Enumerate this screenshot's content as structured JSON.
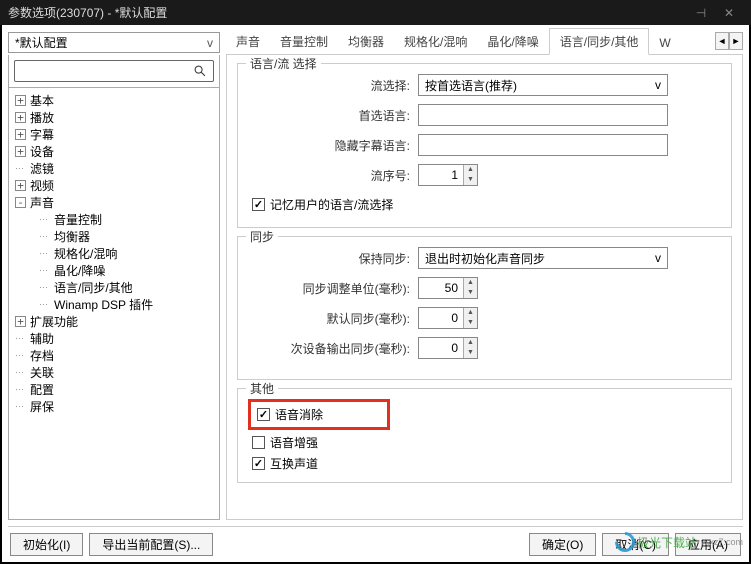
{
  "window": {
    "title": "参数选项(230707) - *默认配置"
  },
  "profile": {
    "selected": "*默认配置"
  },
  "tabs": [
    {
      "label": "声音",
      "active": false
    },
    {
      "label": "音量控制",
      "active": false
    },
    {
      "label": "均衡器",
      "active": false
    },
    {
      "label": "规格化/混响",
      "active": false
    },
    {
      "label": "晶化/降噪",
      "active": false
    },
    {
      "label": "语言/同步/其他",
      "active": true
    },
    {
      "label": "Wi",
      "active": false
    }
  ],
  "tree": [
    {
      "label": "基本",
      "expandable": true,
      "expanded": false,
      "depth": 0
    },
    {
      "label": "播放",
      "expandable": true,
      "expanded": false,
      "depth": 0
    },
    {
      "label": "字幕",
      "expandable": true,
      "expanded": false,
      "depth": 0
    },
    {
      "label": "设备",
      "expandable": true,
      "expanded": false,
      "depth": 0
    },
    {
      "label": "滤镜",
      "expandable": false,
      "depth": 0
    },
    {
      "label": "视频",
      "expandable": true,
      "expanded": false,
      "depth": 0
    },
    {
      "label": "声音",
      "expandable": true,
      "expanded": true,
      "depth": 0
    },
    {
      "label": "音量控制",
      "expandable": false,
      "depth": 1
    },
    {
      "label": "均衡器",
      "expandable": false,
      "depth": 1
    },
    {
      "label": "规格化/混响",
      "expandable": false,
      "depth": 1
    },
    {
      "label": "晶化/降噪",
      "expandable": false,
      "depth": 1
    },
    {
      "label": "语言/同步/其他",
      "expandable": false,
      "depth": 1
    },
    {
      "label": "Winamp DSP 插件",
      "expandable": false,
      "depth": 1
    },
    {
      "label": "扩展功能",
      "expandable": true,
      "expanded": false,
      "depth": 0
    },
    {
      "label": "辅助",
      "expandable": false,
      "depth": 0
    },
    {
      "label": "存档",
      "expandable": false,
      "depth": 0
    },
    {
      "label": "关联",
      "expandable": false,
      "depth": 0
    },
    {
      "label": "配置",
      "expandable": false,
      "depth": 0
    },
    {
      "label": "屏保",
      "expandable": false,
      "depth": 0
    }
  ],
  "groups": {
    "lang": {
      "title": "语言/流 选择",
      "stream_select_label": "流选择:",
      "stream_select_value": "按首选语言(推荐)",
      "pref_lang_label": "首选语言:",
      "hidden_sub_label": "隐藏字幕语言:",
      "stream_no_label": "流序号:",
      "stream_no_value": "1",
      "remember_label": "记忆用户的语言/流选择",
      "remember_checked": true
    },
    "sync": {
      "title": "同步",
      "keep_sync_label": "保持同步:",
      "keep_sync_value": "退出时初始化声音同步",
      "step_label": "同步调整单位(毫秒):",
      "step_value": "50",
      "default_label": "默认同步(毫秒):",
      "default_value": "0",
      "secondary_label": "次设备输出同步(毫秒):",
      "secondary_value": "0"
    },
    "other": {
      "title": "其他",
      "voice_remove_label": "语音消除",
      "voice_remove_checked": true,
      "voice_enhance_label": "语音增强",
      "voice_enhance_checked": false,
      "swap_channel_label": "互换声道",
      "swap_channel_checked": true
    }
  },
  "buttons": {
    "init": "初始化(I)",
    "export": "导出当前配置(S)...",
    "ok": "确定(O)",
    "cancel": "取消(C)",
    "apply": "应用(A)"
  },
  "watermark": {
    "text": "极光下载站",
    "sub": "w.xz7.com"
  }
}
